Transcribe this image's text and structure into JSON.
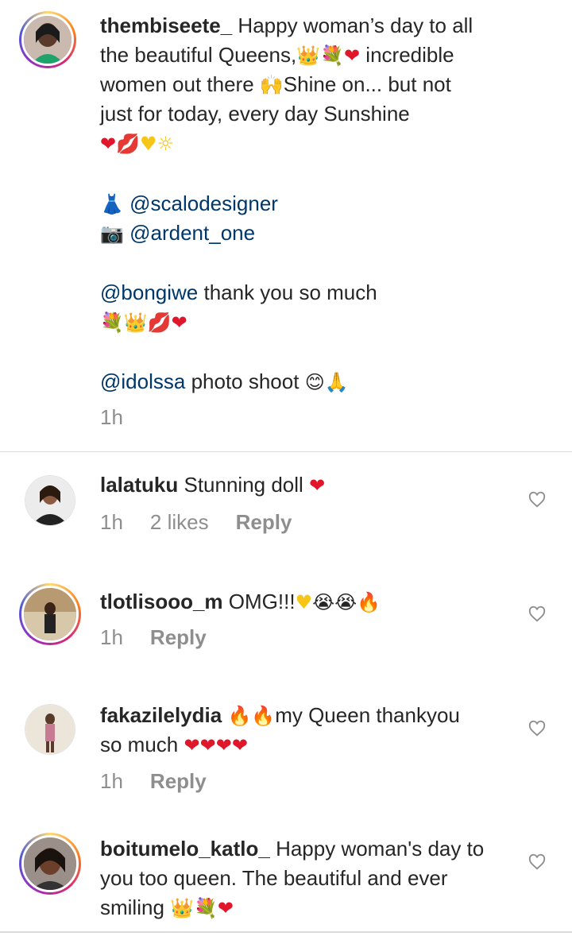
{
  "caption": {
    "username": "thembiseete_",
    "line1": "Happy woman’s day to all",
    "line2a": "the beautiful Queens,",
    "line2b": "incredible",
    "line3a": "women out there",
    "line3b": "Shine on... but not",
    "line4": "just for today, every day Sunshine",
    "dress_mention": "@scalodesigner",
    "camera_mention": "@ardent_one",
    "mention_bongiwe": "@bongiwe",
    "thanks_text": "thank you so much",
    "mention_idolssa": "@idolssa",
    "shoot_text": "photo shoot",
    "time": "1h"
  },
  "comments": [
    {
      "username": "lalatuku",
      "text": "Stunning doll",
      "time": "1h",
      "likes": "2 likes",
      "reply": "Reply"
    },
    {
      "username": "tlotlisooo_m",
      "text": "OMG!!!",
      "time": "1h",
      "reply": "Reply"
    },
    {
      "username": "fakazilelydia",
      "text_a": "my Queen  thankyou",
      "text_b": "so much",
      "time": "1h",
      "reply": "Reply"
    },
    {
      "username": "boitumelo_katlo_",
      "text_a": "Happy woman's day to",
      "text_b": "you too queen. The beautiful and ever",
      "text_c": "smiling",
      "time": ""
    }
  ],
  "colors": {
    "mention": "#00376b",
    "meta": "#8e8e8e",
    "heart_red": "#e0162b"
  },
  "icons": [
    "heart-emoji",
    "crown-emoji",
    "bouquet-emoji",
    "kiss-emoji",
    "yellow-heart-emoji",
    "sun-emoji",
    "dress-emoji",
    "camera-emoji",
    "raised-hands-emoji",
    "smile-emoji",
    "pray-emoji",
    "crying-emoji",
    "fire-emoji",
    "heart-outline-icon"
  ]
}
